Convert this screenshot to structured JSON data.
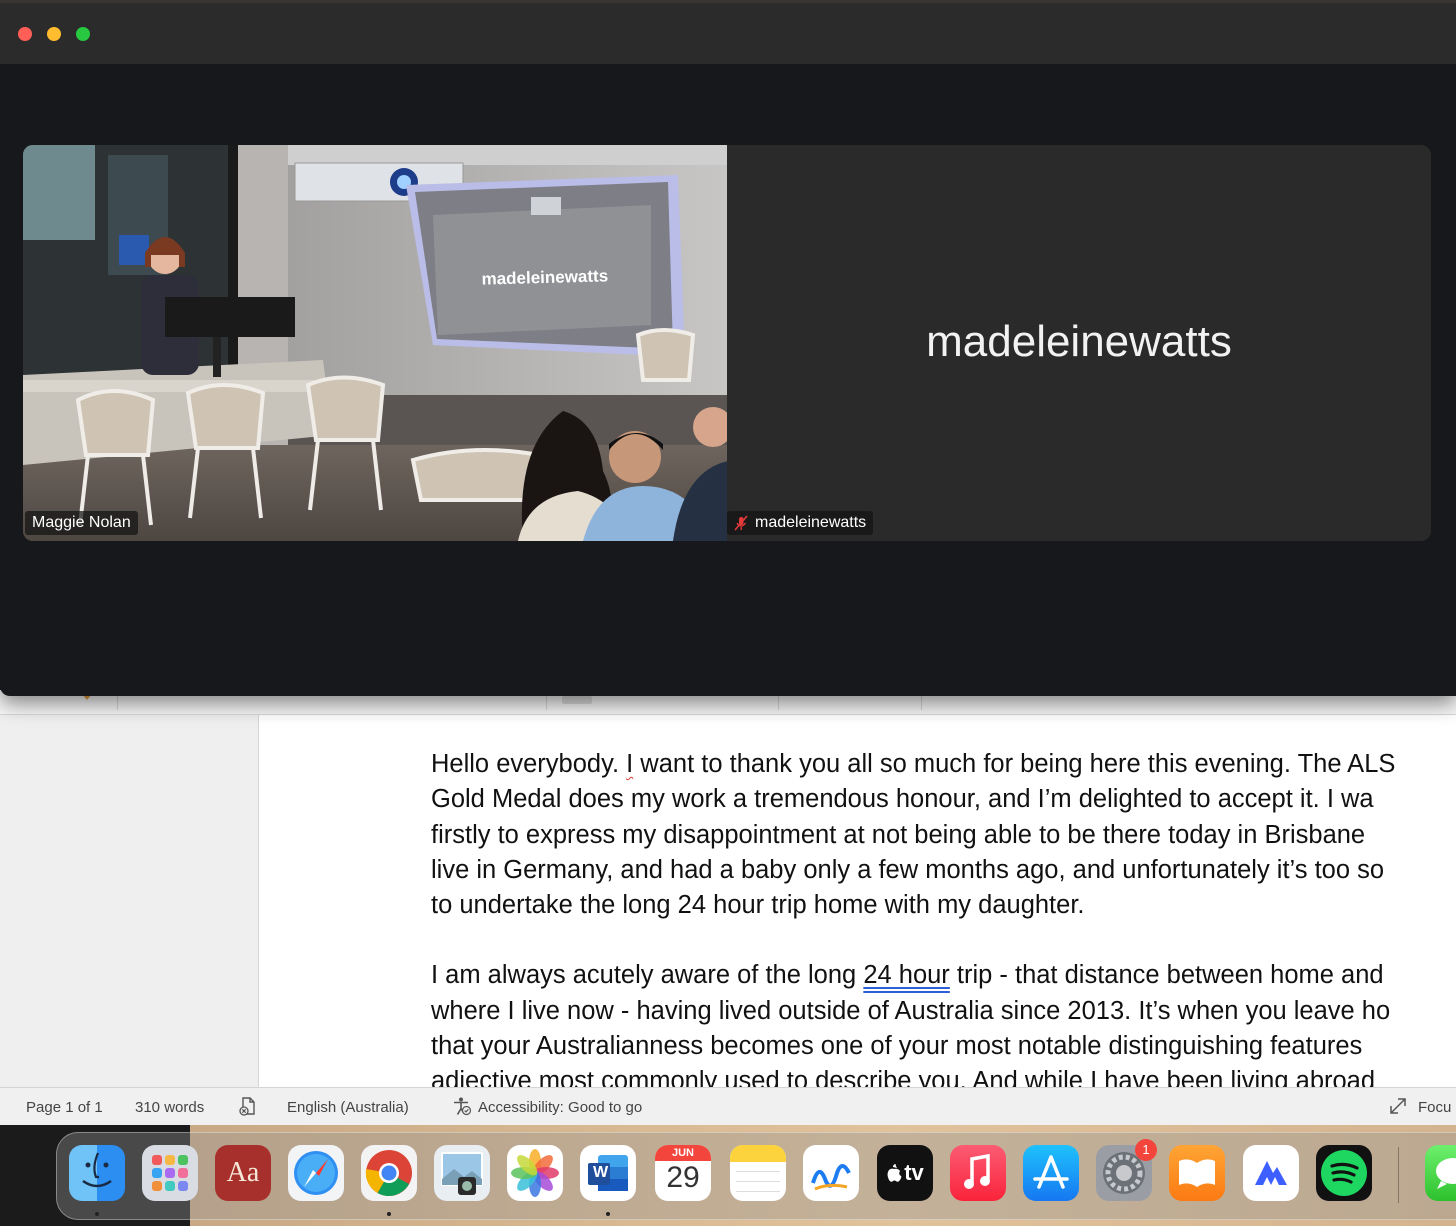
{
  "zoom": {
    "participants": [
      {
        "name": "Maggie Nolan",
        "screen_text": "madeleinewatts"
      },
      {
        "name": "madeleinewatts",
        "display": "madeleinewatts",
        "muted": true
      }
    ]
  },
  "document": {
    "paragraphs": [
      [
        [
          "Hello everybody. ",
          {
            "t": "I",
            "style": "spell"
          },
          " want to thank you all so much for being here this evening. The ALS"
        ],
        [
          "Gold Medal does my work a tremendous honour, and I’m delighted to accept it. I wa"
        ],
        [
          "firstly to express my disappointment at not being able to be there today in Brisbane"
        ],
        [
          "live in Germany, and had a baby only a few months ago, and unfortunately it’s too so"
        ],
        [
          "to undertake the long 24 hour trip home with my daughter."
        ]
      ],
      [
        [
          "I am always acutely aware of the long ",
          {
            "t": "24 hour",
            "style": "gram"
          },
          " trip - that distance between home and"
        ],
        [
          "where I live now - having lived outside of Australia since 2013. It’s when you leave ho"
        ],
        [
          "that your Australianness becomes one of your most notable distinguishing features"
        ],
        [
          "adjective most commonly used to describe you. And while I have been living abroad"
        ]
      ]
    ]
  },
  "statusbar": {
    "page": "Page 1 of 1",
    "words": "310 words",
    "language": "English (Australia)",
    "accessibility": "Accessibility: Good to go",
    "focus": "Focu"
  },
  "dock": {
    "calendar_month": "JUN",
    "calendar_day": "29",
    "dictionary_label": "Aa",
    "appletv_label": "tv",
    "settings_badge": "1",
    "word_letter": "W"
  },
  "colors": {
    "close": "#ff5f57",
    "minimize": "#febc2e",
    "zoom": "#28c840",
    "spell_underline": "#d33333",
    "grammar_underline": "#2d5fd6"
  }
}
